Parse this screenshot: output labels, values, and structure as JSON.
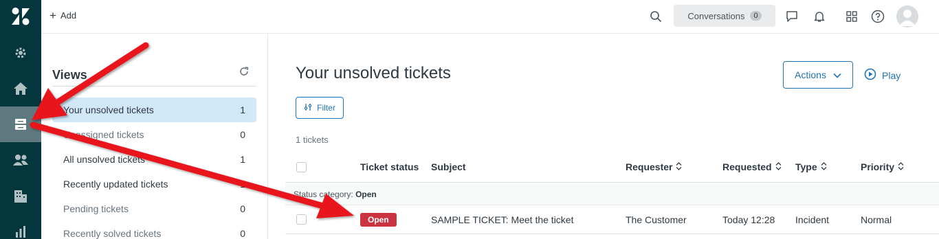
{
  "topbar": {
    "add_label": "Add",
    "conversations_label": "Conversations",
    "conversations_count": "0"
  },
  "rail": {
    "items": [
      "logo-icon",
      "settings-icon",
      "home-icon",
      "views-icon",
      "customers-icon",
      "organizations-icon",
      "reporting-icon"
    ],
    "active": "views-icon"
  },
  "views": {
    "title": "Views",
    "items": [
      {
        "label": "Your unsolved tickets",
        "count": "1"
      },
      {
        "label": "Unassigned tickets",
        "count": "0"
      },
      {
        "label": "All unsolved tickets",
        "count": "1"
      },
      {
        "label": "Recently updated tickets",
        "count": "1"
      },
      {
        "label": "Pending tickets",
        "count": "0"
      },
      {
        "label": "Recently solved tickets",
        "count": "0"
      }
    ]
  },
  "main": {
    "title": "Your unsolved tickets",
    "actions_label": "Actions",
    "play_label": "Play",
    "filter_label": "Filter",
    "ticket_count": "1 tickets",
    "columns": {
      "status": "Ticket status",
      "subject": "Subject",
      "requester": "Requester",
      "requested": "Requested",
      "type": "Type",
      "priority": "Priority"
    },
    "group": {
      "prefix": "Status category:",
      "value": "Open"
    },
    "rows": [
      {
        "status": "Open",
        "subject": "SAMPLE TICKET: Meet the ticket",
        "requester": "The Customer",
        "requested": "Today 12:28",
        "type": "Incident",
        "priority": "Normal"
      }
    ]
  },
  "colors": {
    "rail_bg": "#03363d",
    "accent": "#1f73b7",
    "active_view_bg": "#d1e8f8",
    "open_badge": "#cc3340",
    "annotation_arrow": "#e8141b"
  }
}
